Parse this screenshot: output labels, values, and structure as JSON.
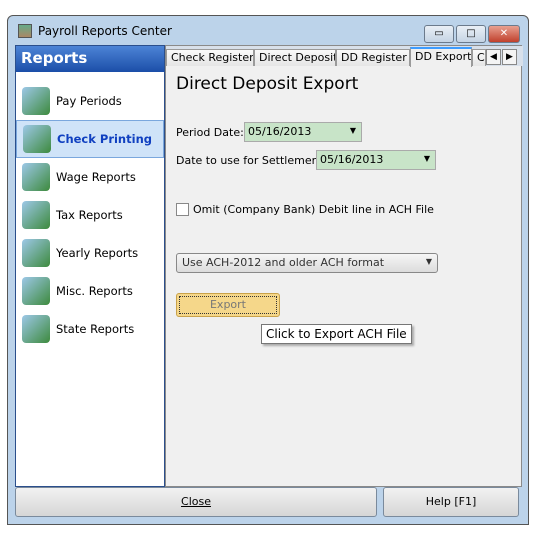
{
  "window": {
    "title": "Payroll Reports Center",
    "minimize": "▭",
    "maximize": "□",
    "close": "✕"
  },
  "sidebar": {
    "header": "Reports",
    "items": [
      {
        "label": "Pay Periods",
        "selected": false
      },
      {
        "label": "Check Printing",
        "selected": true
      },
      {
        "label": "Wage Reports",
        "selected": false
      },
      {
        "label": "Tax Reports",
        "selected": false
      },
      {
        "label": "Yearly Reports",
        "selected": false
      },
      {
        "label": "Misc. Reports",
        "selected": false
      },
      {
        "label": "State Reports",
        "selected": false
      }
    ]
  },
  "tabs": [
    {
      "label": "Check Register"
    },
    {
      "label": "Direct Deposit"
    },
    {
      "label": "DD Register"
    },
    {
      "label": "DD Export",
      "active": true
    },
    {
      "label": "C"
    }
  ],
  "tab_scroll": {
    "left": "◀",
    "right": "▶"
  },
  "main": {
    "title": "Direct Deposit Export",
    "period_date_label": "Period Date:",
    "period_date": "05/16/2013",
    "settlement_label": "Date to use for Settlement:",
    "settlement_date": "05/16/2013",
    "omit_label": "Omit (Company Bank) Debit line in ACH File",
    "omit_checked": false,
    "format_select": "Use ACH-2012 and older ACH format",
    "export_button": "Export",
    "tooltip": "Click to Export ACH File"
  },
  "footer": {
    "close": "Close",
    "help": "Help [F1]"
  }
}
